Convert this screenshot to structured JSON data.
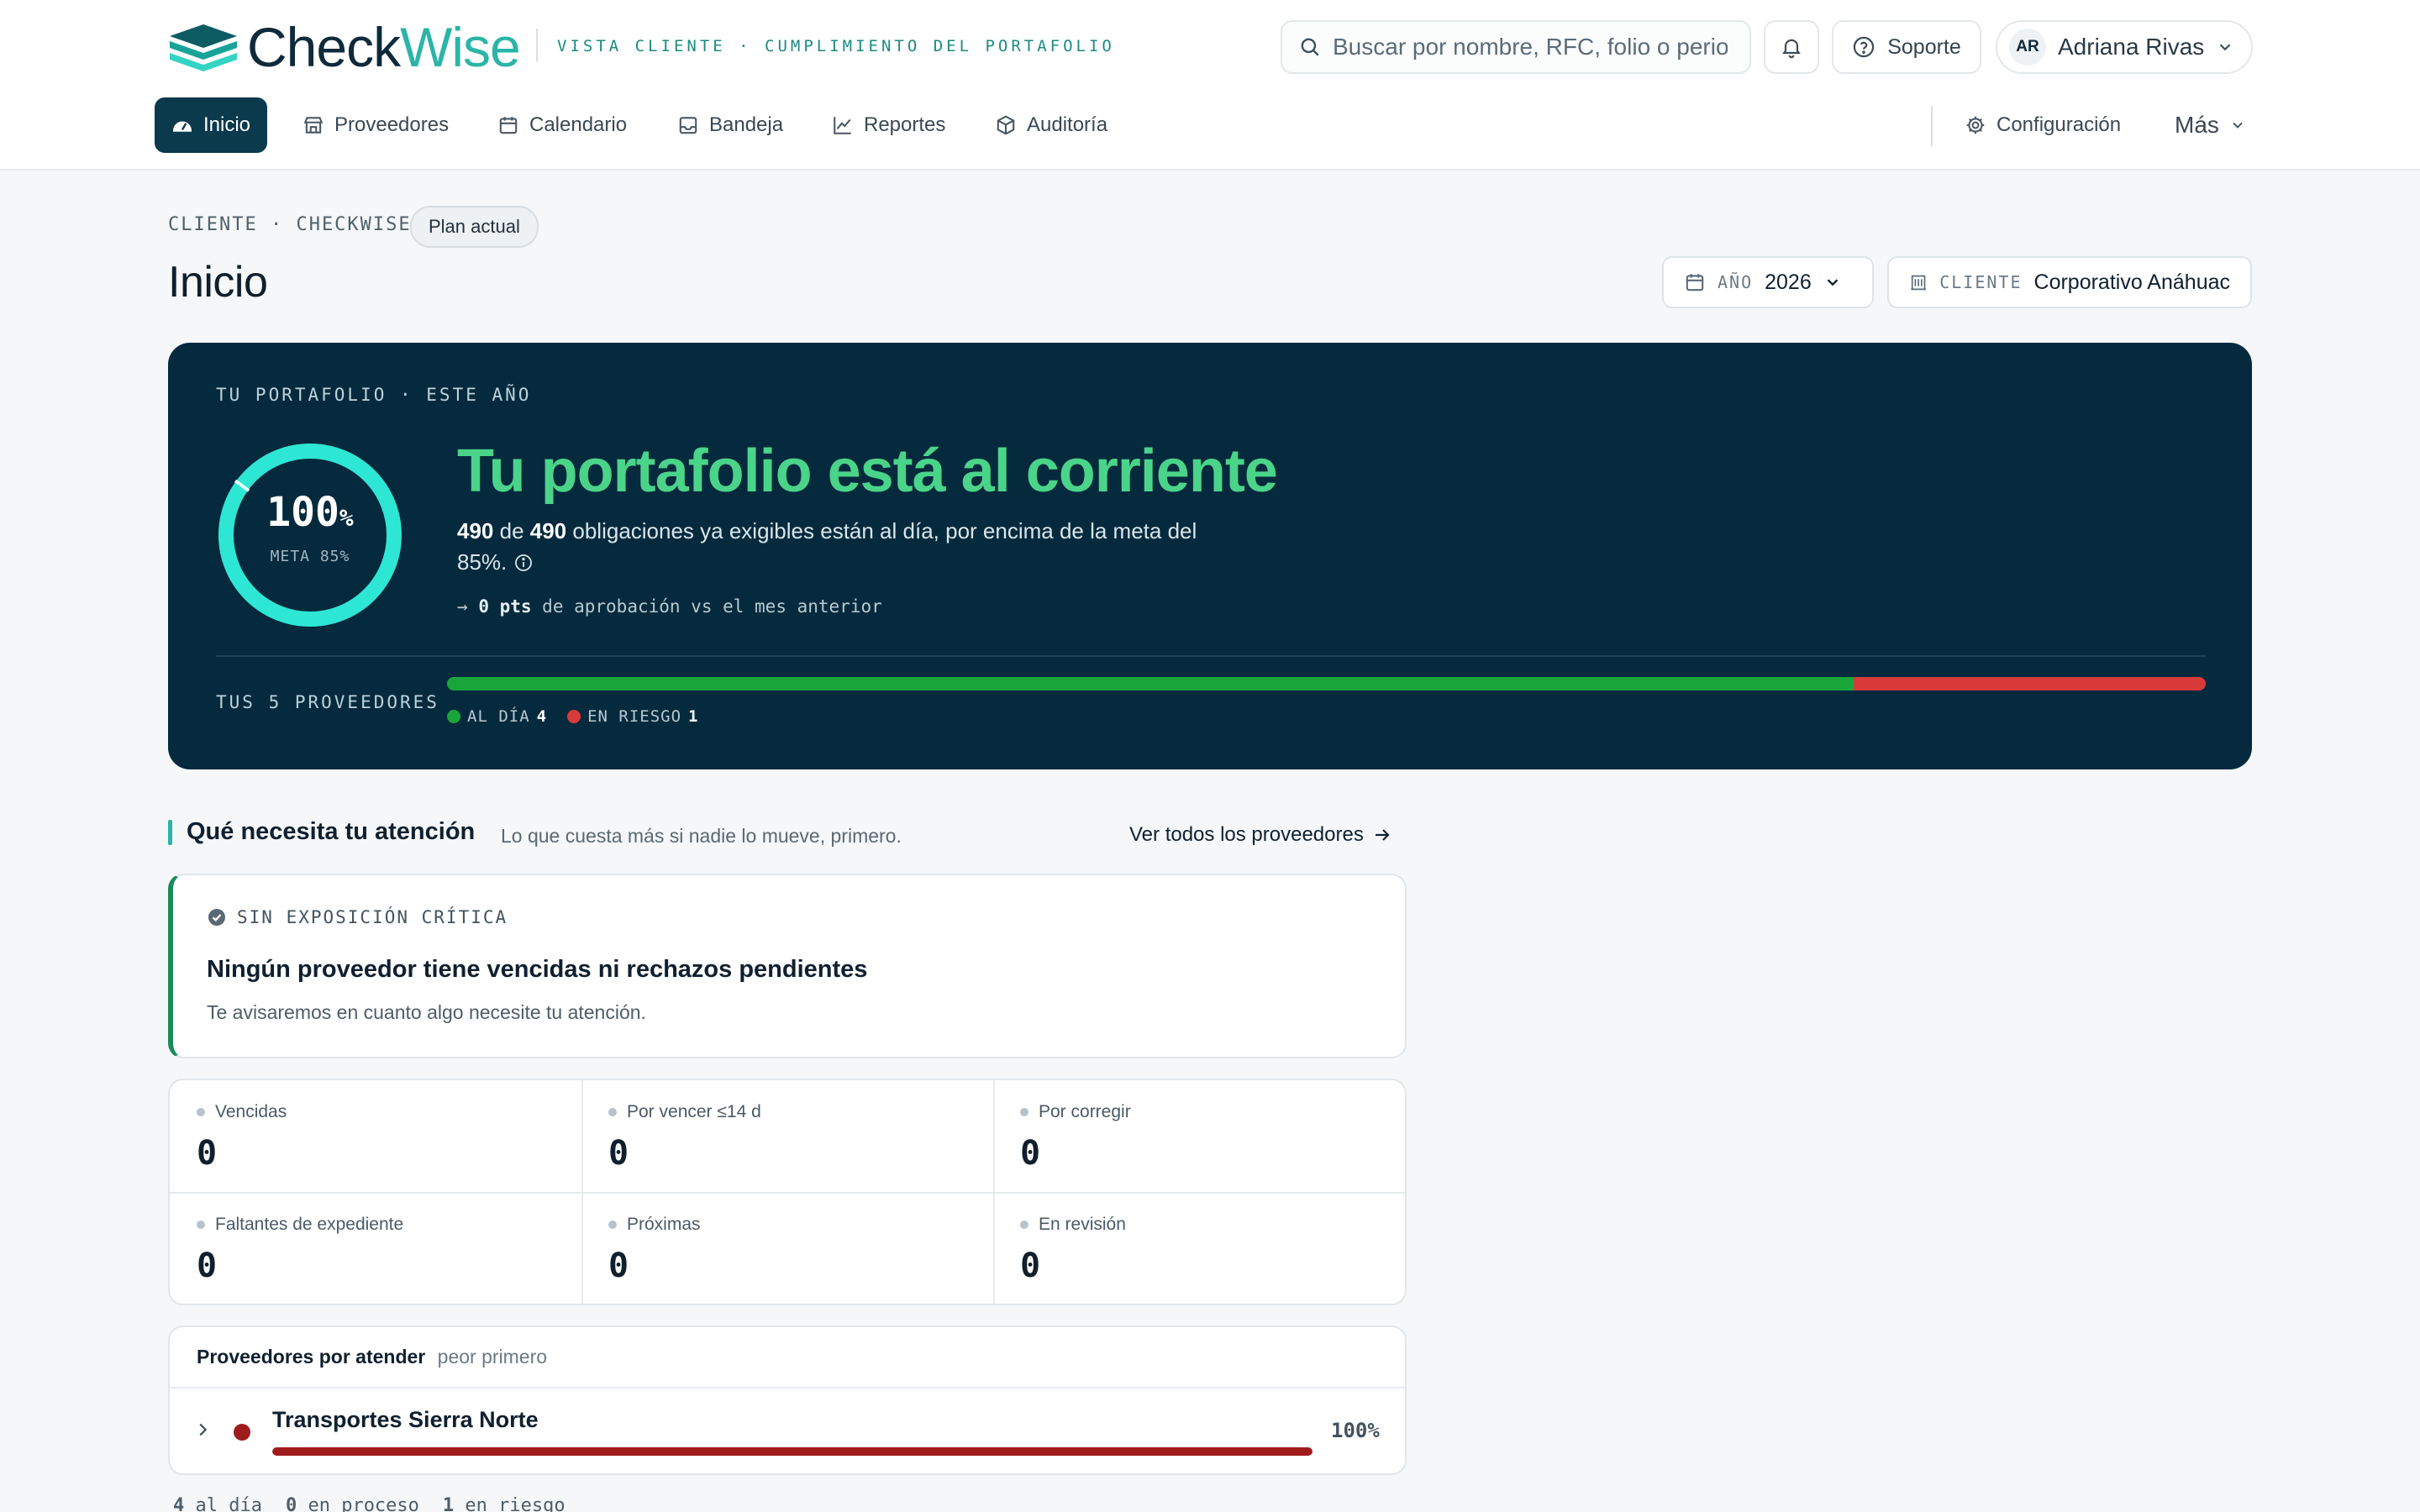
{
  "app": {
    "logo_part1": "Check",
    "logo_part2": "Wise",
    "tagline": "VISTA CLIENTE · CUMPLIMIENTO DEL PORTAFOLIO"
  },
  "search": {
    "placeholder": "Buscar por nombre, RFC, folio o periodo"
  },
  "header": {
    "support_label": "Soporte",
    "user_initials": "AR",
    "user_name": "Adriana Rivas"
  },
  "nav": {
    "items": [
      {
        "label": "Inicio",
        "icon": "gauge-icon",
        "active": true
      },
      {
        "label": "Proveedores",
        "icon": "store-icon"
      },
      {
        "label": "Calendario",
        "icon": "calendar-icon"
      },
      {
        "label": "Bandeja",
        "icon": "inbox-icon"
      },
      {
        "label": "Reportes",
        "icon": "chart-icon"
      },
      {
        "label": "Auditoría",
        "icon": "box-icon"
      }
    ],
    "settings_label": "Configuración",
    "more_label": "Más"
  },
  "page": {
    "crumb": "CLIENTE · CHECKWISE",
    "plan_badge": "Plan actual",
    "title": "Inicio",
    "year_label": "AÑO",
    "year_value": "2026",
    "client_label": "CLIENTE",
    "client_value": "Corporativo Anáhuac"
  },
  "hero": {
    "kicker": "TU PORTAFOLIO · ESTE AÑO",
    "ring_percent": 100,
    "ring_value": "100",
    "ring_unit": "%",
    "ring_goal": "META 85%",
    "headline": "Tu portafolio está al corriente",
    "done": "490",
    "de": " de ",
    "total": "490",
    "desc_rest": " obligaciones ya exigibles están al día, por encima de la meta del",
    "desc_line2": "85%.",
    "delta_arrow": "→",
    "delta_value": "0 pts",
    "delta_text": " de aprobación vs el mes anterior",
    "providers_label": "TUS 5 PROVEEDORES",
    "providers_total": 5,
    "legend": [
      {
        "label": "AL DÍA",
        "value": 4,
        "color": "#1aa53a"
      },
      {
        "label": "EN RIESGO",
        "value": 1,
        "color": "#d83a3a"
      }
    ]
  },
  "attention": {
    "title": "Qué necesita tu atención",
    "subtitle": "Lo que cuesta más si nadie lo mueve, primero.",
    "link": "Ver todos los proveedores",
    "alert_kicker": "SIN EXPOSICIÓN CRÍTICA",
    "alert_title": "Ningún proveedor tiene vencidas ni rechazos pendientes",
    "alert_text": "Te avisaremos en cuanto algo necesite tu atención."
  },
  "stats": [
    {
      "label": "Vencidas",
      "value": "0"
    },
    {
      "label": "Por vencer ≤14 d",
      "value": "0"
    },
    {
      "label": "Por corregir",
      "value": "0"
    },
    {
      "label": "Faltantes de expediente",
      "value": "0"
    },
    {
      "label": "Próximas",
      "value": "0"
    },
    {
      "label": "En revisión",
      "value": "0"
    }
  ],
  "providers_list": {
    "title": "Proveedores por atender",
    "subtitle": "peor primero",
    "rows": [
      {
        "name": "Transportes Sierra Norte",
        "percent_label": "100%",
        "progress": 1.0
      }
    ],
    "footer": [
      {
        "value": "4",
        "label": " al día"
      },
      {
        "value": "0",
        "label": " en proceso"
      },
      {
        "value": "1",
        "label": " en riesgo"
      }
    ]
  },
  "colors": {
    "brand_dark": "#062a3d",
    "accent_teal": "#2ee6d4",
    "ok_green": "#1aa53a",
    "risk_red": "#d83a3a",
    "headline_green": "#4ad489"
  }
}
